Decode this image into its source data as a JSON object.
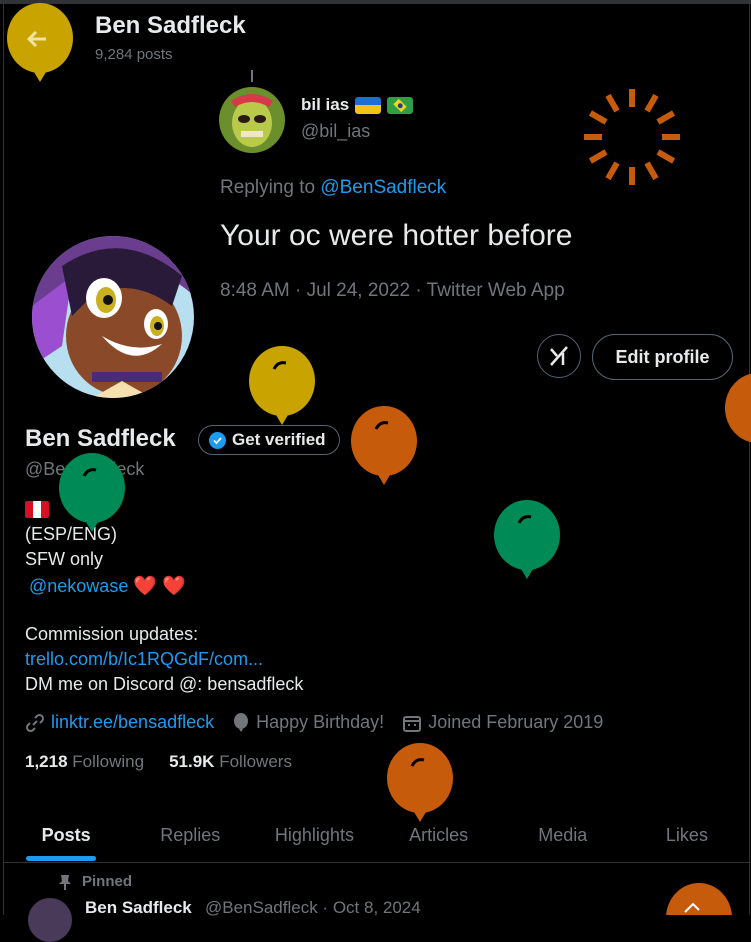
{
  "header": {
    "name": "Ben Sadfleck",
    "post_count": "9,284 posts",
    "back_icon": "back-arrow-icon"
  },
  "banner_tweet": {
    "author_name": "bil ias",
    "author_handle": "@bil_ias",
    "replying_to_prefix": "Replying to ",
    "replying_to_handle": "@BenSadfleck",
    "text": "Your oc were hotter before",
    "meta": "8:48 AM · Jul 24, 2022 · Twitter Web App"
  },
  "profile": {
    "name": "Ben Sadfleck",
    "handle": "@BenSadfleck",
    "get_verified_label": "Get verified",
    "edit_profile_label": "Edit profile",
    "bio": {
      "langs": "(ESP/ENG)",
      "sfw": "SFW only",
      "partner": "@nekowase",
      "commission_label": "Commission updates:",
      "commission_link": "trello.com/b/Ic1RQGdF/com...",
      "discord": "DM me on Discord @: bensadfleck"
    },
    "website": "linktr.ee/bensadfleck",
    "birthday": "Happy Birthday!",
    "joined": "Joined February 2019",
    "following_count": "1,218",
    "following_label": "Following",
    "followers_count": "51.9K",
    "followers_label": "Followers"
  },
  "tabs": [
    "Posts",
    "Replies",
    "Highlights",
    "Articles",
    "Media",
    "Likes"
  ],
  "active_tab": "Posts",
  "pinned_post": {
    "pinned_label": "Pinned",
    "author_name": "Ben Sadfleck",
    "rest": "@BenSadfleck · Oct 8, 2024"
  },
  "colors": {
    "accent": "#1d9bf0",
    "balloon_yellow": "#c9a300",
    "balloon_orange": "#c75b0c",
    "balloon_green": "#008a55",
    "spinner": "#c75b0c"
  }
}
